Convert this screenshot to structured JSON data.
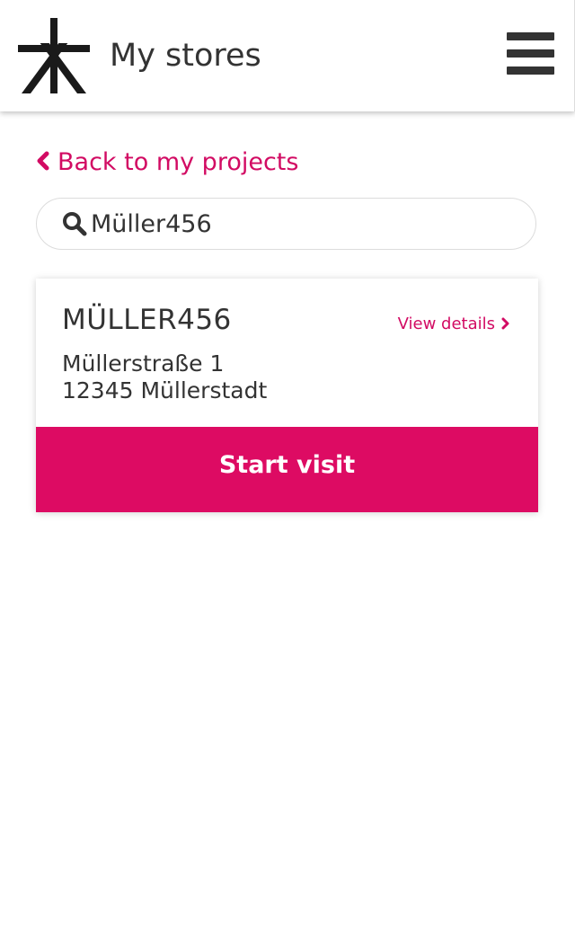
{
  "header": {
    "title": "My stores",
    "logo": "brand-logo-icon",
    "menu_icon": "hamburger-menu-icon"
  },
  "nav": {
    "back_label": "Back to my projects",
    "back_icon": "chevron-left-icon"
  },
  "search": {
    "icon": "search-icon",
    "value": "Müller456"
  },
  "store_card": {
    "name": "MÜLLER456",
    "view_details_label": "View details",
    "view_details_icon": "chevron-right-icon",
    "address_line1": "Müllerstraße 1",
    "address_line2": "12345 Müllerstadt",
    "start_visit_label": "Start visit"
  },
  "colors": {
    "accent": "#dd0b63",
    "text": "#333333",
    "background": "#ffffff"
  }
}
